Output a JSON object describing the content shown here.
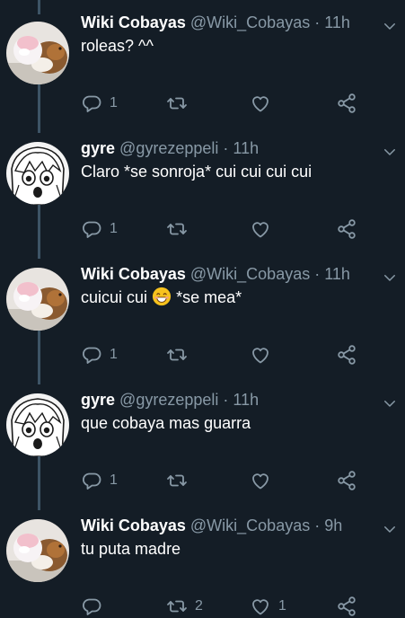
{
  "colors": {
    "background": "#141d26",
    "secondary_text": "#8899a6",
    "thread_line": "#3d5466"
  },
  "icons": {
    "reply": "reply-icon",
    "retweet": "retweet-icon",
    "like": "heart-icon",
    "share": "share-icon",
    "menu": "chevron-down-icon",
    "emoji": "smiling-face-emoji"
  },
  "tweets": [
    {
      "display_name": "Wiki Cobayas",
      "handle": "@Wiki_Cobayas",
      "separator": "·",
      "time": "11h",
      "text": "roleas? ^^",
      "reply_count": "1",
      "retweet_count": "",
      "like_count": ""
    },
    {
      "display_name": "gyre",
      "handle": "@gyrezeppeli",
      "separator": "·",
      "time": "11h",
      "text": "Claro *se sonroja* cui cui cui cui",
      "reply_count": "1",
      "retweet_count": "",
      "like_count": ""
    },
    {
      "display_name": "Wiki Cobayas",
      "handle": "@Wiki_Cobayas",
      "separator": "·",
      "time": "11h",
      "text_before": "cuicui cui",
      "text_after": "*se mea*",
      "reply_count": "1",
      "retweet_count": "",
      "like_count": ""
    },
    {
      "display_name": "gyre",
      "handle": "@gyrezeppeli",
      "separator": "·",
      "time": "11h",
      "text": "que cobaya mas guarra",
      "reply_count": "1",
      "retweet_count": "",
      "like_count": ""
    },
    {
      "display_name": "Wiki Cobayas",
      "handle": "@Wiki_Cobayas",
      "separator": "·",
      "time": "9h",
      "text": "tu puta madre",
      "reply_count": "",
      "retweet_count": "2",
      "like_count": "1"
    }
  ]
}
